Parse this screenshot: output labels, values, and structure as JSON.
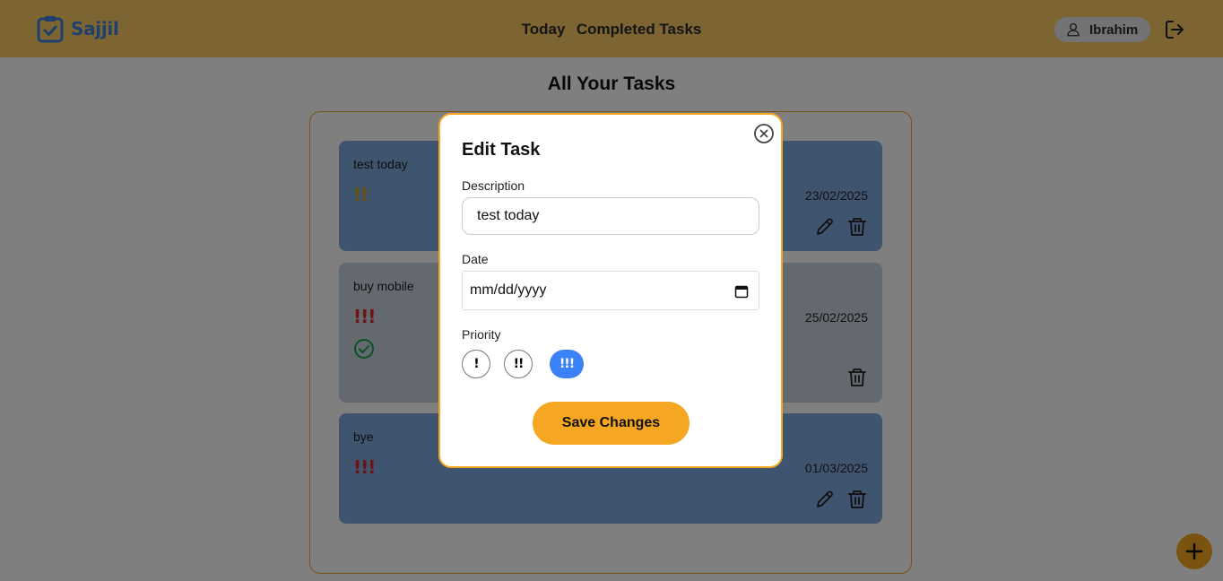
{
  "app": {
    "name": "Sajjil"
  },
  "nav": {
    "today": "Today",
    "completed": "Completed Tasks"
  },
  "user": {
    "name": "Ibrahim"
  },
  "main": {
    "title": "All Your Tasks"
  },
  "tasks": [
    {
      "description": "test today",
      "priority": "!!",
      "priority_color": "#d4a017",
      "date": "23/02/2025",
      "completed": false,
      "background": "#7fa9dd"
    },
    {
      "description": "buy mobile",
      "priority": "!!!",
      "priority_color": "#dc2626",
      "date": "25/02/2025",
      "completed": true,
      "background": "#c9d3de"
    },
    {
      "description": "bye",
      "priority": "!!!",
      "priority_color": "#dc2626",
      "date": "01/03/2025",
      "completed": false,
      "background": "#7fa9dd"
    }
  ],
  "modal": {
    "title": "Edit Task",
    "description_label": "Description",
    "description_value": "test today",
    "date_label": "Date",
    "date_placeholder": "mm/dd/yyyy",
    "priority_label": "Priority",
    "priority_options": [
      "!",
      "!!",
      "!!!"
    ],
    "priority_selected": "!!!",
    "save_label": "Save Changes"
  },
  "colors": {
    "accent": "#f5a623",
    "brand": "#3e7fd9",
    "selected": "#3b82f6",
    "header": "#fbc866"
  },
  "icons": {
    "logo": "clipboard-check-icon",
    "user": "user-icon",
    "logout": "logout-icon",
    "edit": "pencil-icon",
    "delete": "trash-icon",
    "completed": "check-circle-icon",
    "close": "close-circle-icon",
    "calendar": "calendar-icon",
    "add": "plus-icon"
  }
}
